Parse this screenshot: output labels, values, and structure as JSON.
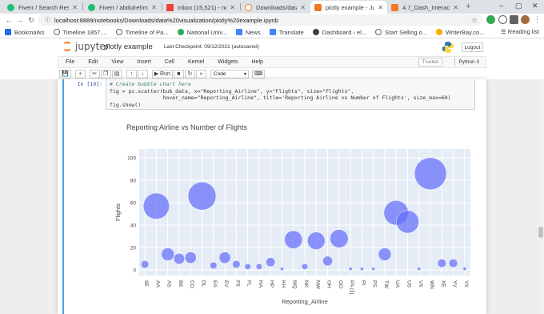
{
  "browser": {
    "tabs": [
      {
        "title": "Fiverr / Search Resu",
        "color": "#1dbf73"
      },
      {
        "title": "Fiverr / abdulrehma",
        "color": "#1dbf73"
      },
      {
        "title": "Inbox (15,521) - nou",
        "color": "#ea4335"
      },
      {
        "title": "Downloads/data vis",
        "color": "#f37726"
      },
      {
        "title": "plotly example - Jup",
        "color": "#f37726"
      },
      {
        "title": "4.7_Dash_Interactiv",
        "color": "#f37726"
      }
    ],
    "new_tab": "+",
    "url": "localhost:8889/notebooks/Downloads/data%20visualization/plotly%20example.ipynb",
    "bookmarks": [
      {
        "label": "Bookmarks",
        "color": "#1a73e8"
      },
      {
        "label": "Timeline 1857....",
        "color": "#5f6368"
      },
      {
        "label": "Timeline of Pa...",
        "color": "#5f6368"
      },
      {
        "label": "National Univ...",
        "color": "#34a853"
      },
      {
        "label": "News",
        "color": "#4285f4"
      },
      {
        "label": "Translate",
        "color": "#4285f4"
      },
      {
        "label": "Dashboard ‹ el...",
        "color": "#3c4043"
      },
      {
        "label": "Start Selling o...",
        "color": "#5f6368"
      },
      {
        "label": "WriterBay.co...",
        "color": "#f9ab00"
      }
    ],
    "reading_list": "Reading list"
  },
  "jupyter": {
    "logo_text": "jupyter",
    "notebook_name": "plotly example",
    "checkpoint": "Last Checkpoint: 09/12/2021  (autosaved)",
    "logout": "Logout",
    "menus": [
      "File",
      "Edit",
      "View",
      "Insert",
      "Cell",
      "Kernel",
      "Widgets",
      "Help"
    ],
    "trusted": "Trusted",
    "kernel": "Python 3",
    "toolbar": {
      "run": "Run",
      "cell_type": "Code"
    }
  },
  "cell": {
    "prompt": "In [19]:",
    "code_lines": [
      "# Create bubble chart here",
      "fig = px.scatter(bub_data, x=\"Reporting_Airline\", y=\"Flights\", size=\"Flights\",",
      "                 hover_name=\"Reporting_Airline\", title='Reporting Airline vs Number of Flights', size_max=60)",
      "fig.show()"
    ]
  },
  "chart_data": {
    "type": "scatter",
    "title": "Reporting Airline vs Number of Flights",
    "xlabel": "Reporting_Airline",
    "ylabel": "Flights",
    "ylim": [
      -5,
      108
    ],
    "yticks": [
      0,
      20,
      40,
      60,
      80,
      100
    ],
    "categories": [
      "9E",
      "AA",
      "AS",
      "B6",
      "CO",
      "DL",
      "EA",
      "EV",
      "F9",
      "FL",
      "HA",
      "HP",
      "KH",
      "MQ",
      "NK",
      "NW",
      "OH",
      "OO",
      "PA (1)",
      "PI",
      "PS",
      "TW",
      "UA",
      "US",
      "VX",
      "WN",
      "XE",
      "YV",
      "YX"
    ],
    "series": [
      {
        "values": [
          5,
          57,
          14,
          10,
          11,
          66,
          4,
          11,
          5,
          3,
          3,
          7,
          1,
          27,
          3,
          26,
          8,
          28,
          1,
          1,
          1,
          14,
          51,
          43,
          1,
          86,
          6,
          6,
          1
        ]
      }
    ],
    "colors": {
      "marker": "#636efa",
      "plot_bg": "#e5ecf6"
    }
  }
}
